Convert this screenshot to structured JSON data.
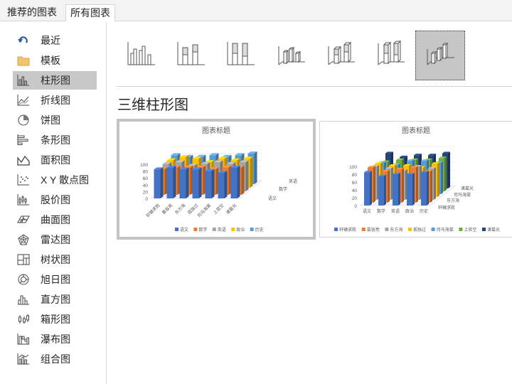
{
  "tabs": [
    {
      "label": "推荐的图表",
      "active": false
    },
    {
      "label": "所有图表",
      "active": true
    }
  ],
  "sidebar": {
    "items": [
      {
        "label": "最近",
        "icon": "undo-arrow-icon"
      },
      {
        "label": "模板",
        "icon": "folder-icon"
      },
      {
        "label": "柱形图",
        "icon": "column-chart-icon",
        "selected": true
      },
      {
        "label": "折线图",
        "icon": "line-chart-icon"
      },
      {
        "label": "饼图",
        "icon": "pie-chart-icon"
      },
      {
        "label": "条形图",
        "icon": "bar-chart-icon"
      },
      {
        "label": "面积图",
        "icon": "area-chart-icon"
      },
      {
        "label": "X Y 散点图",
        "icon": "scatter-chart-icon"
      },
      {
        "label": "股价图",
        "icon": "stock-chart-icon"
      },
      {
        "label": "曲面图",
        "icon": "surface-chart-icon"
      },
      {
        "label": "雷达图",
        "icon": "radar-chart-icon"
      },
      {
        "label": "树状图",
        "icon": "treemap-chart-icon"
      },
      {
        "label": "旭日图",
        "icon": "sunburst-chart-icon"
      },
      {
        "label": "直方图",
        "icon": "histogram-chart-icon"
      },
      {
        "label": "箱形图",
        "icon": "box-whisker-chart-icon"
      },
      {
        "label": "瀑布图",
        "icon": "waterfall-chart-icon"
      },
      {
        "label": "组合图",
        "icon": "combo-chart-icon"
      }
    ]
  },
  "subtypes": [
    {
      "icon": "clustered-column-icon",
      "selected": false
    },
    {
      "icon": "stacked-column-icon",
      "selected": false
    },
    {
      "icon": "100-stacked-column-icon",
      "selected": false
    },
    {
      "icon": "3d-clustered-column-icon",
      "selected": false
    },
    {
      "icon": "3d-stacked-column-icon",
      "selected": false
    },
    {
      "icon": "3d-100-stacked-column-icon",
      "selected": false
    },
    {
      "icon": "3d-column-icon",
      "selected": true
    }
  ],
  "section_title": "三维柱形图",
  "colors": {
    "series": [
      "#4472c4",
      "#ed7d31",
      "#a5a5a5",
      "#ffc000",
      "#5b9bd5",
      "#70ad47",
      "#264478"
    ],
    "selected_bg": "#c8c8c8"
  },
  "chart_data": [
    {
      "type": "bar",
      "subtype": "3d-column",
      "title": "图表标题",
      "categories": [
        "轩辕求败",
        "慕容亮",
        "东方海",
        "孤独过",
        "司马海棠",
        "上官空",
        "诸葛光"
      ],
      "series": [
        {
          "name": "语文",
          "values": [
            85,
            90,
            85,
            85,
            80,
            75,
            90
          ]
        },
        {
          "name": "数学",
          "values": [
            75,
            80,
            80,
            80,
            75,
            80,
            80
          ]
        },
        {
          "name": "英语",
          "values": [
            80,
            85,
            75,
            80,
            85,
            80,
            85
          ]
        },
        {
          "name": "政治",
          "values": [
            80,
            90,
            85,
            75,
            85,
            80,
            85
          ]
        },
        {
          "name": "历史",
          "values": [
            85,
            80,
            80,
            85,
            80,
            85,
            90
          ]
        }
      ],
      "yticks": [
        0,
        20,
        40,
        60,
        80,
        100
      ],
      "ylim": [
        0,
        100
      ],
      "legend": "bottom"
    },
    {
      "type": "bar",
      "subtype": "3d-column",
      "title": "图表标题",
      "categories": [
        "语文",
        "数学",
        "英语",
        "政治",
        "历史"
      ],
      "series": [
        {
          "name": "轩辕求败",
          "values": [
            85,
            75,
            80,
            80,
            85
          ]
        },
        {
          "name": "慕容亮",
          "values": [
            90,
            80,
            85,
            90,
            80
          ]
        },
        {
          "name": "东方海",
          "values": [
            85,
            80,
            75,
            85,
            80
          ]
        },
        {
          "name": "孤独过",
          "values": [
            85,
            80,
            80,
            75,
            85
          ]
        },
        {
          "name": "司马海棠",
          "values": [
            80,
            75,
            85,
            85,
            80
          ]
        },
        {
          "name": "上官空",
          "values": [
            75,
            80,
            80,
            80,
            85
          ]
        },
        {
          "name": "诸葛光",
          "values": [
            90,
            80,
            85,
            85,
            90
          ]
        }
      ],
      "depth_labels": [
        "诸葛光",
        "司马海棠",
        "东方海",
        "轩辕求败"
      ],
      "yticks": [
        0,
        20,
        40,
        60,
        80,
        100
      ],
      "ylim": [
        0,
        100
      ],
      "legend": "bottom"
    }
  ]
}
